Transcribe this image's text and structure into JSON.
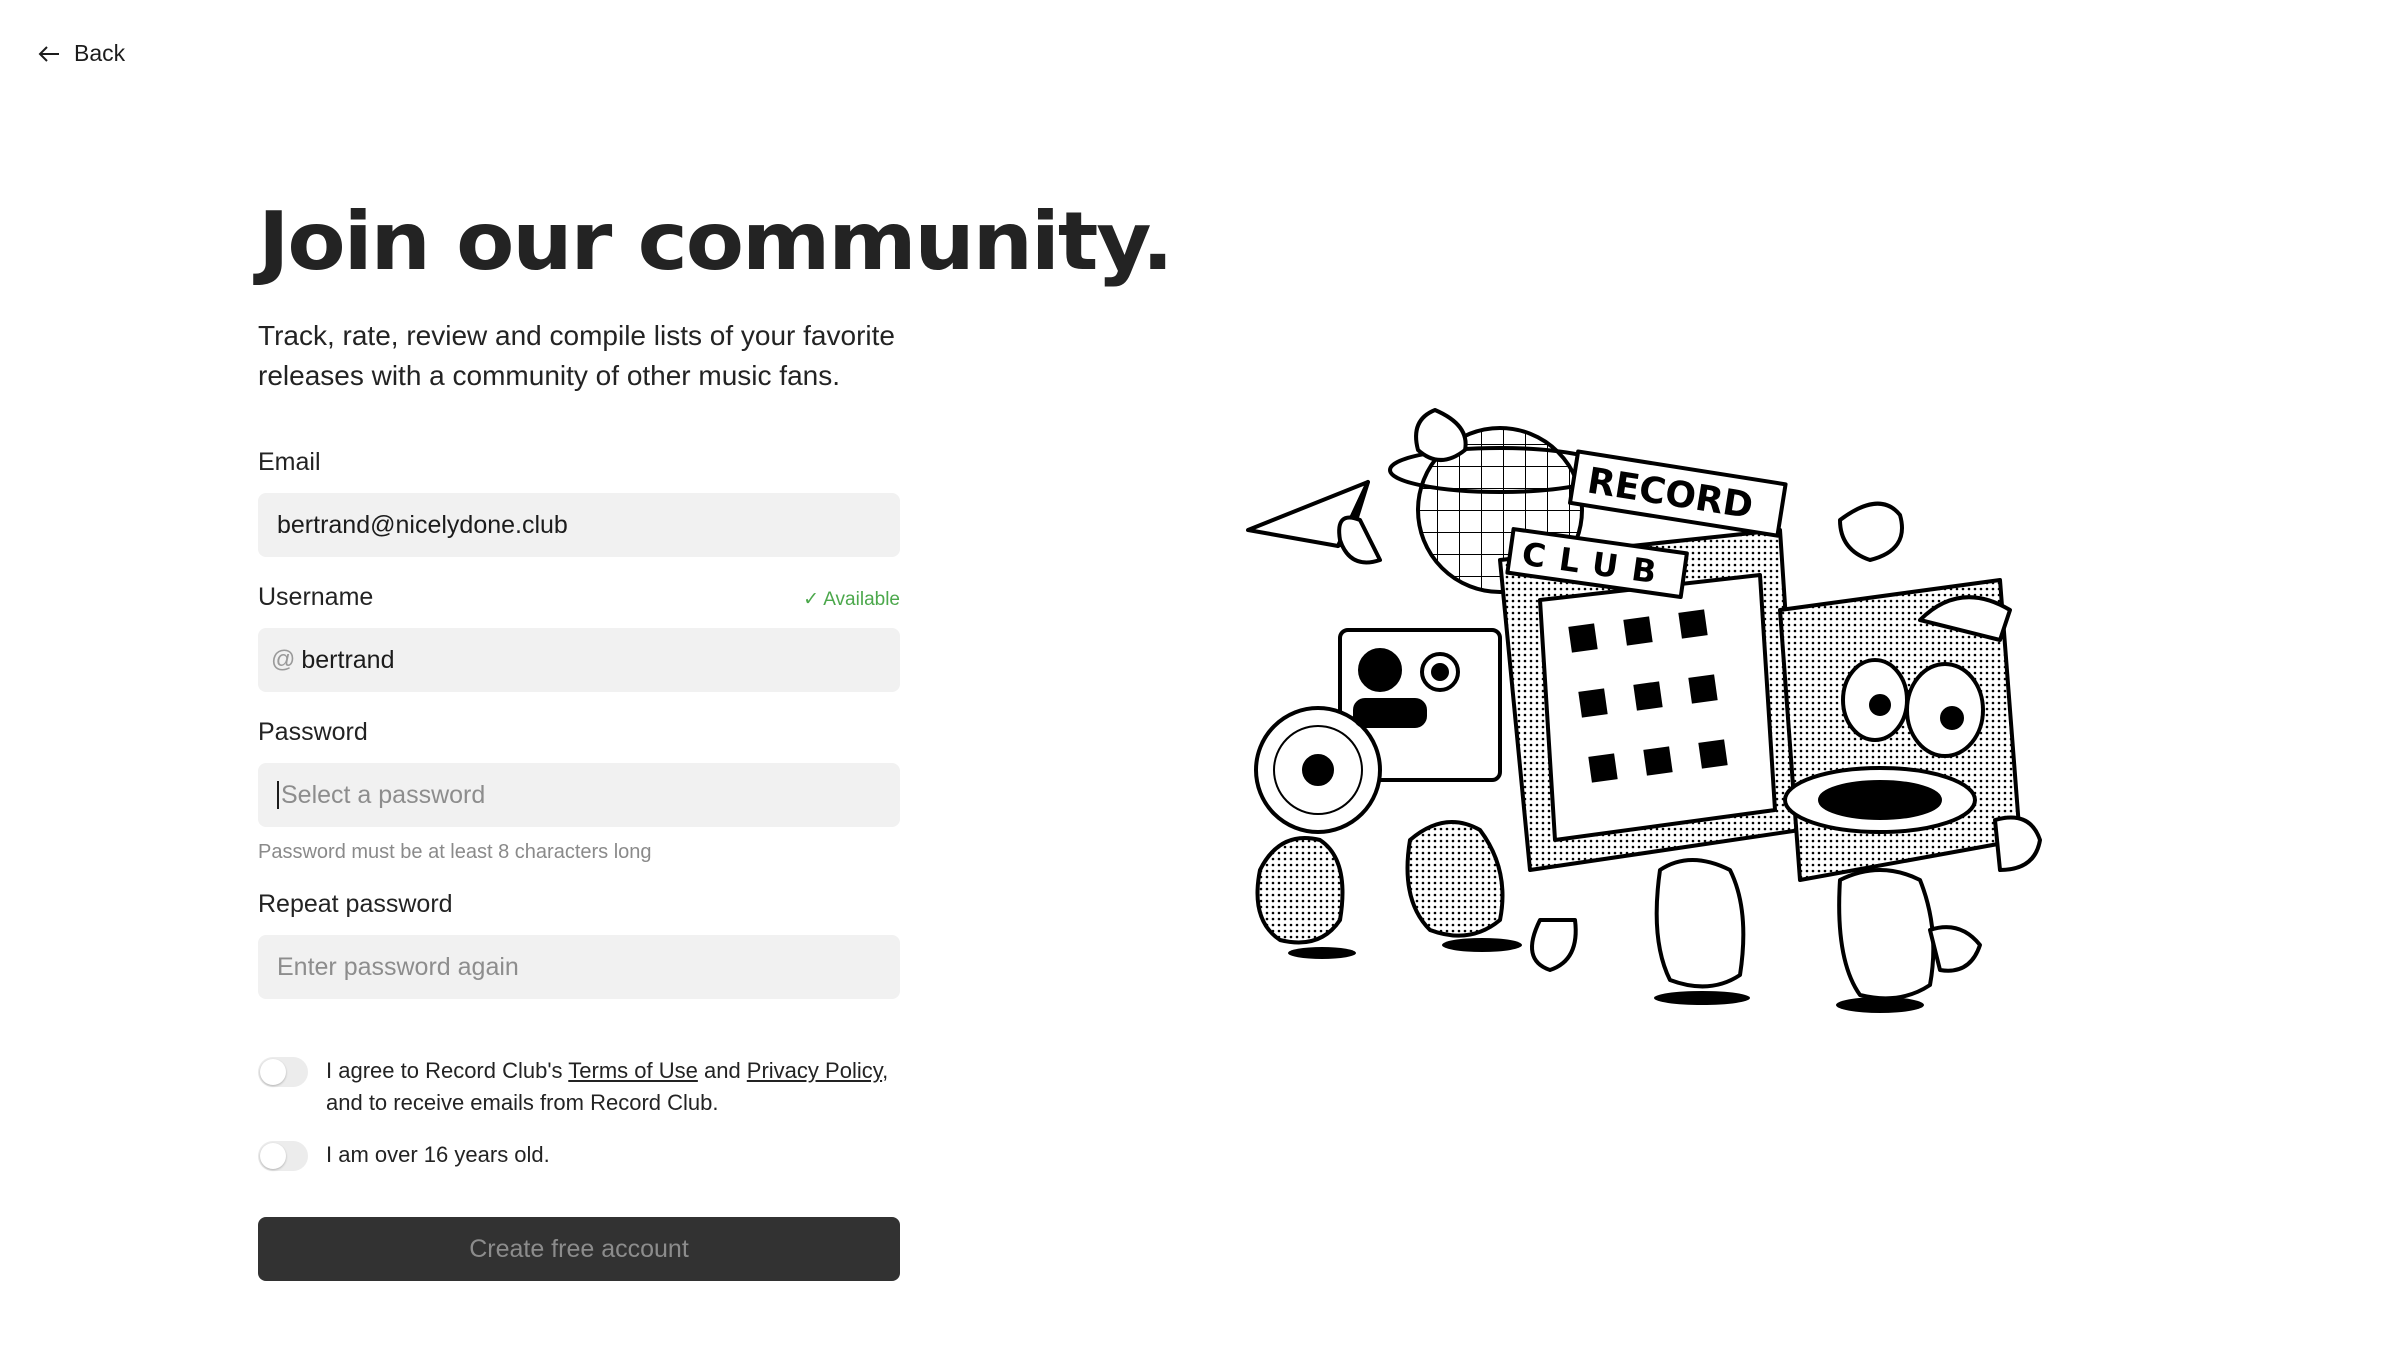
{
  "nav": {
    "back_label": "Back"
  },
  "hero": {
    "title": "Join our community.",
    "subtitle": "Track, rate, review and compile lists of your favorite releases with a community of other music fans."
  },
  "form": {
    "email": {
      "label": "Email",
      "value": "bertrand@nicelydone.club"
    },
    "username": {
      "label": "Username",
      "prefix": "@",
      "value": "bertrand",
      "status": "✓ Available"
    },
    "password": {
      "label": "Password",
      "placeholder": "Select a password",
      "hint": "Password must be at least 8 characters long"
    },
    "repeat_password": {
      "label": "Repeat password",
      "placeholder": "Enter password again"
    },
    "terms": {
      "text_before": "I agree to Record Club's ",
      "terms_link": "Terms of Use",
      "text_and": " and ",
      "privacy_link": "Privacy Policy",
      "text_after": ", and to receive emails from Record Club.",
      "checked": false
    },
    "age": {
      "text": "I am over 16 years old.",
      "checked": false
    },
    "submit_label": "Create free account"
  },
  "illustration": {
    "sign_top": "RECORD",
    "sign_bottom": "CLUB"
  },
  "colors": {
    "accent_available": "#4ca84c",
    "button_bg": "#323232",
    "input_bg": "#f1f1f1"
  }
}
